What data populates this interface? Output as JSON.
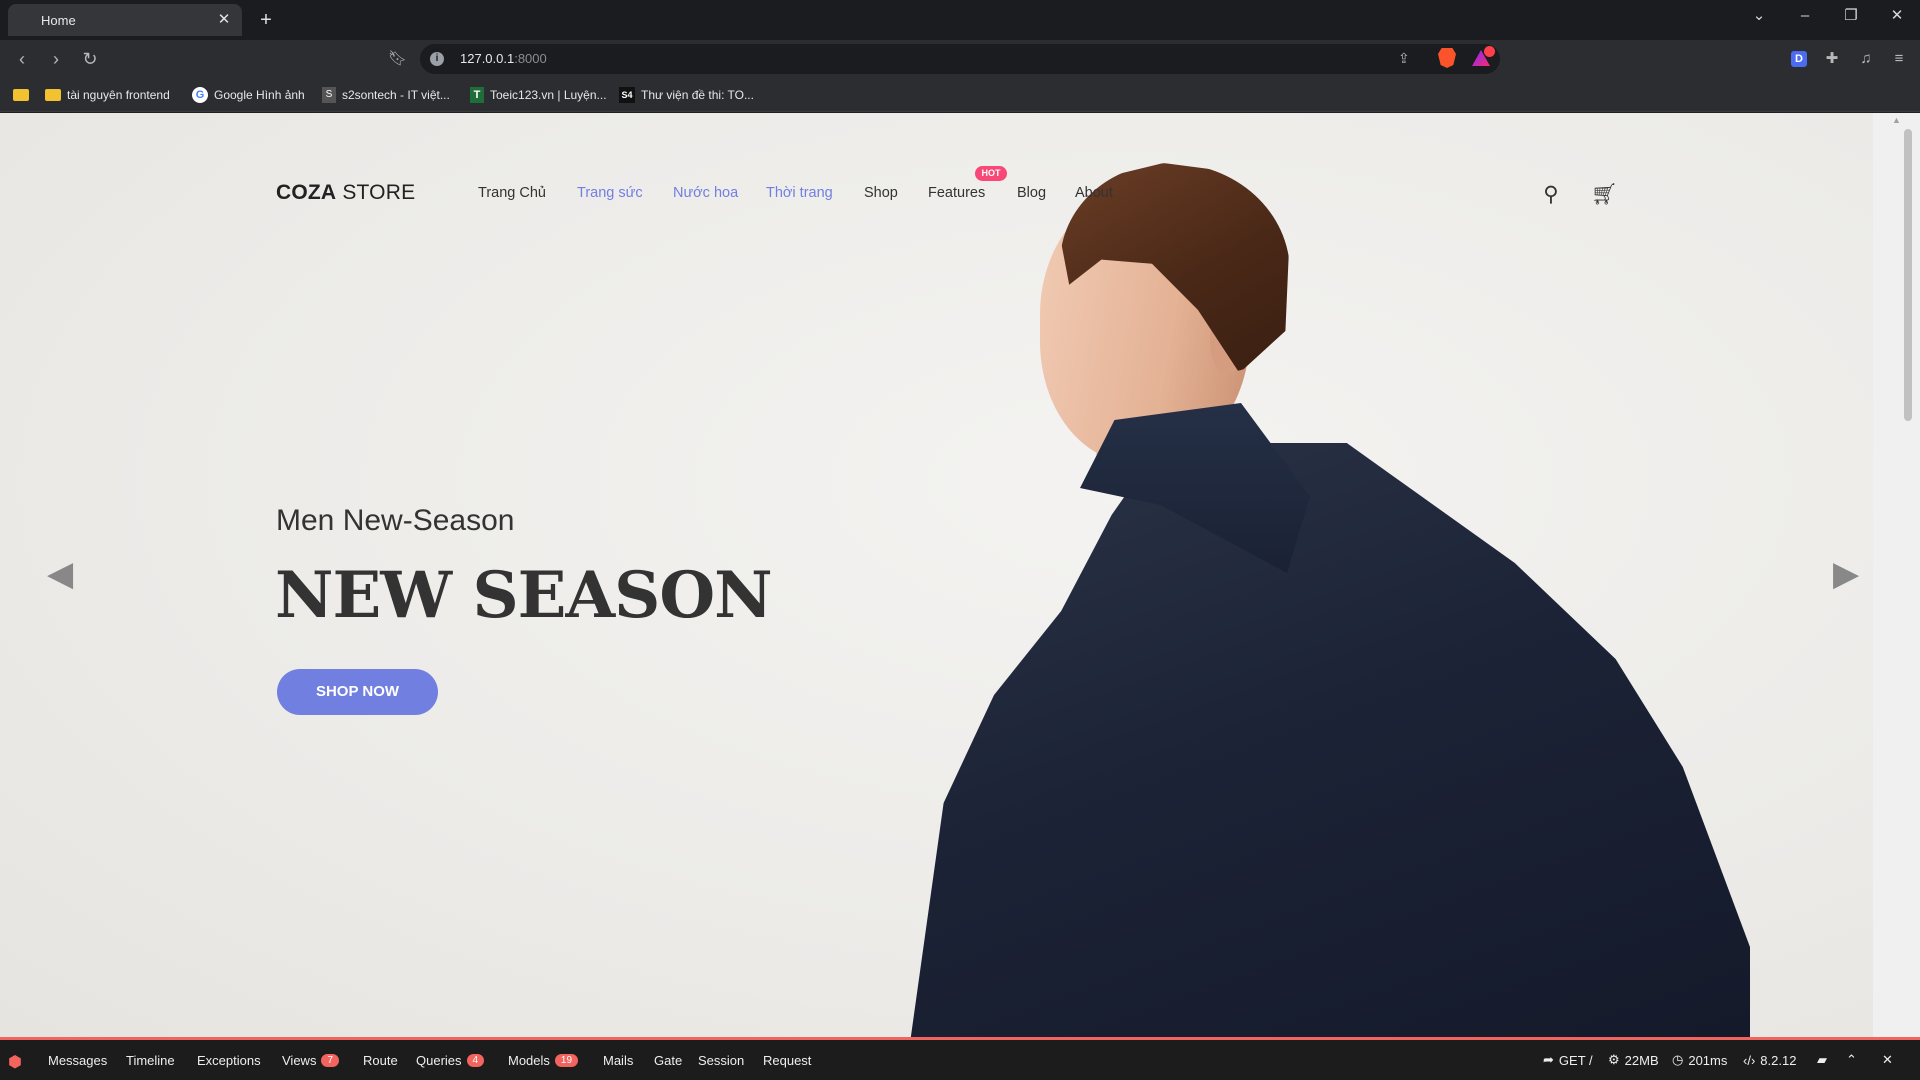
{
  "browser": {
    "tab_title": "Home",
    "url_host": "127.0.0.1",
    "url_port": ":8000",
    "bookmarks": [
      {
        "label": "",
        "icon": "folder-icon"
      },
      {
        "label": "tài nguyên frontend",
        "icon": "folder-icon"
      },
      {
        "label": "Google Hình ảnh",
        "icon": "google-icon"
      },
      {
        "label": "s2sontech - IT việt...",
        "icon": "s2sontech-icon"
      },
      {
        "label": "Toeic123.vn | Luyện...",
        "icon": "toeic-icon"
      },
      {
        "label": "Thư viện đề thi: TO...",
        "icon": "s4-icon"
      }
    ]
  },
  "site": {
    "logo_bold": "COZA",
    "logo_rest": " STORE",
    "nav": [
      {
        "label": "Trang Chủ"
      },
      {
        "label": "Trang sức"
      },
      {
        "label": "Nước hoa"
      },
      {
        "label": "Thời trang"
      },
      {
        "label": "Shop"
      },
      {
        "label": "Features"
      },
      {
        "label": "Blog"
      },
      {
        "label": "About"
      }
    ],
    "hot_badge": "HOT",
    "accent_color": "#717fe0",
    "hero": {
      "subtitle": "Men New-Season",
      "title": "NEW SEASON",
      "button": "SHOP NOW"
    }
  },
  "debugbar": {
    "items": [
      {
        "label": "Messages"
      },
      {
        "label": "Timeline"
      },
      {
        "label": "Exceptions"
      },
      {
        "label": "Views",
        "badge": "7"
      },
      {
        "label": "Route"
      },
      {
        "label": "Queries",
        "badge": "4"
      },
      {
        "label": "Models",
        "badge": "19"
      },
      {
        "label": "Mails"
      },
      {
        "label": "Gate"
      },
      {
        "label": "Session"
      },
      {
        "label": "Request"
      }
    ],
    "method": "GET /",
    "memory": "22MB",
    "time": "201ms",
    "php_version": "8.2.12"
  }
}
